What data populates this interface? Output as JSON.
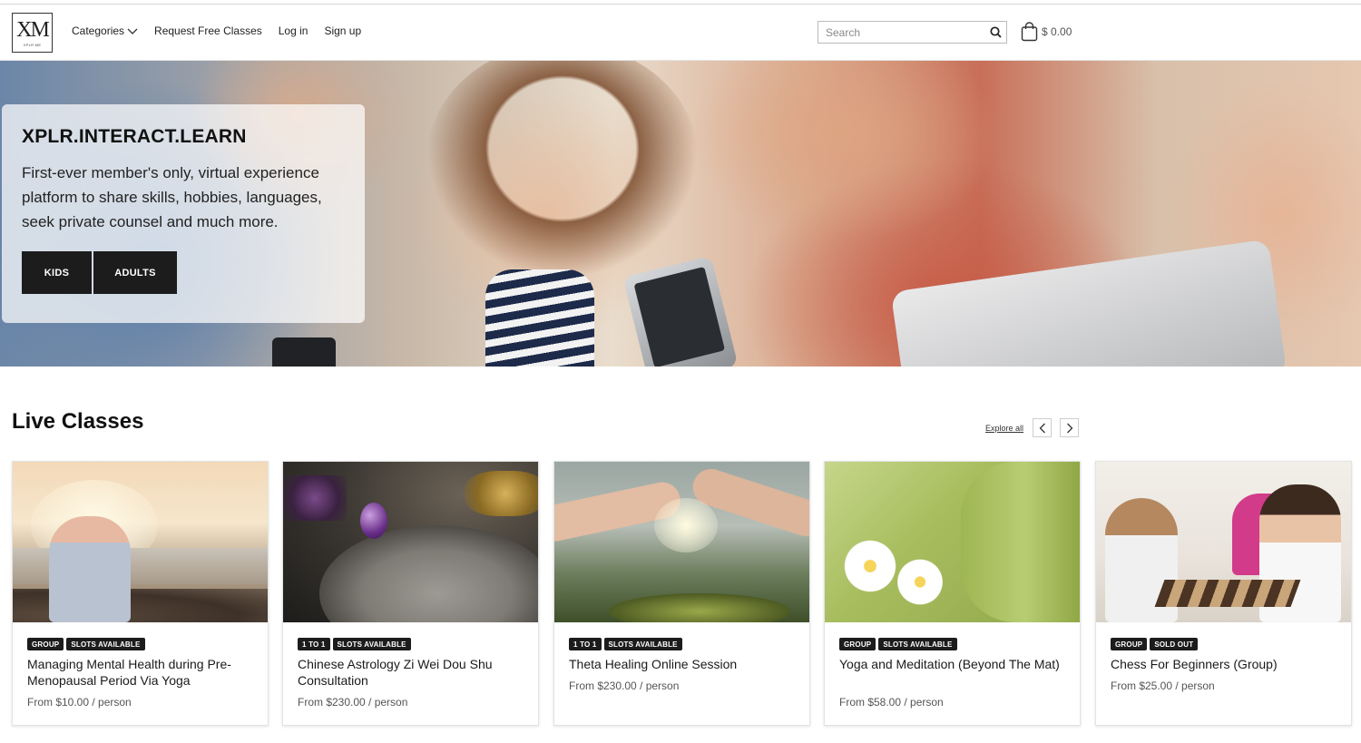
{
  "header": {
    "logo_mark": "XM",
    "logo_sub": "XPLR ME",
    "nav": {
      "categories": "Categories",
      "request_free": "Request Free Classes",
      "login": "Log in",
      "signup": "Sign up"
    },
    "search_placeholder": "Search",
    "cart_total": "$ 0.00"
  },
  "hero": {
    "title": "XPLR.INTERACT.LEARN",
    "description": "First-ever member's only, virtual experience platform to share skills, hobbies, languages, seek private counsel and much more.",
    "buttons": {
      "kids": "KIDS",
      "adults": "ADULTS"
    }
  },
  "live_classes": {
    "title": "Live Classes",
    "explore_all": "Explore all",
    "cards": [
      {
        "badges": [
          "GROUP",
          "SLOTS AVAILABLE"
        ],
        "title": "Managing Mental Health during Pre-Menopausal Period Via Yoga",
        "price": "From $10.00 / person"
      },
      {
        "badges": [
          "1 TO 1",
          "SLOTS AVAILABLE"
        ],
        "title": "Chinese Astrology Zi Wei Dou Shu Consultation",
        "price": "From $230.00 / person"
      },
      {
        "badges": [
          "1 TO 1",
          "SLOTS AVAILABLE"
        ],
        "title": "Theta Healing Online Session",
        "price": "From $230.00 / person"
      },
      {
        "badges": [
          "GROUP",
          "SLOTS AVAILABLE"
        ],
        "title": "Yoga and Meditation (Beyond The Mat)",
        "price": "From $58.00 / person"
      },
      {
        "badges": [
          "GROUP",
          "SOLD OUT"
        ],
        "title": "Chess For Beginners (Group)",
        "price": "From $25.00 / person"
      }
    ]
  },
  "icons": {
    "search": "search-icon",
    "cart": "shopping-bag-icon",
    "chevron": "chevron-down-icon",
    "prev": "chevron-left-icon",
    "next": "chevron-right-icon"
  },
  "colors": {
    "button_bg": "#1c1c1c",
    "badge_bg": "#1c1c1c",
    "text": "#1a1a1a",
    "muted": "#555555"
  }
}
